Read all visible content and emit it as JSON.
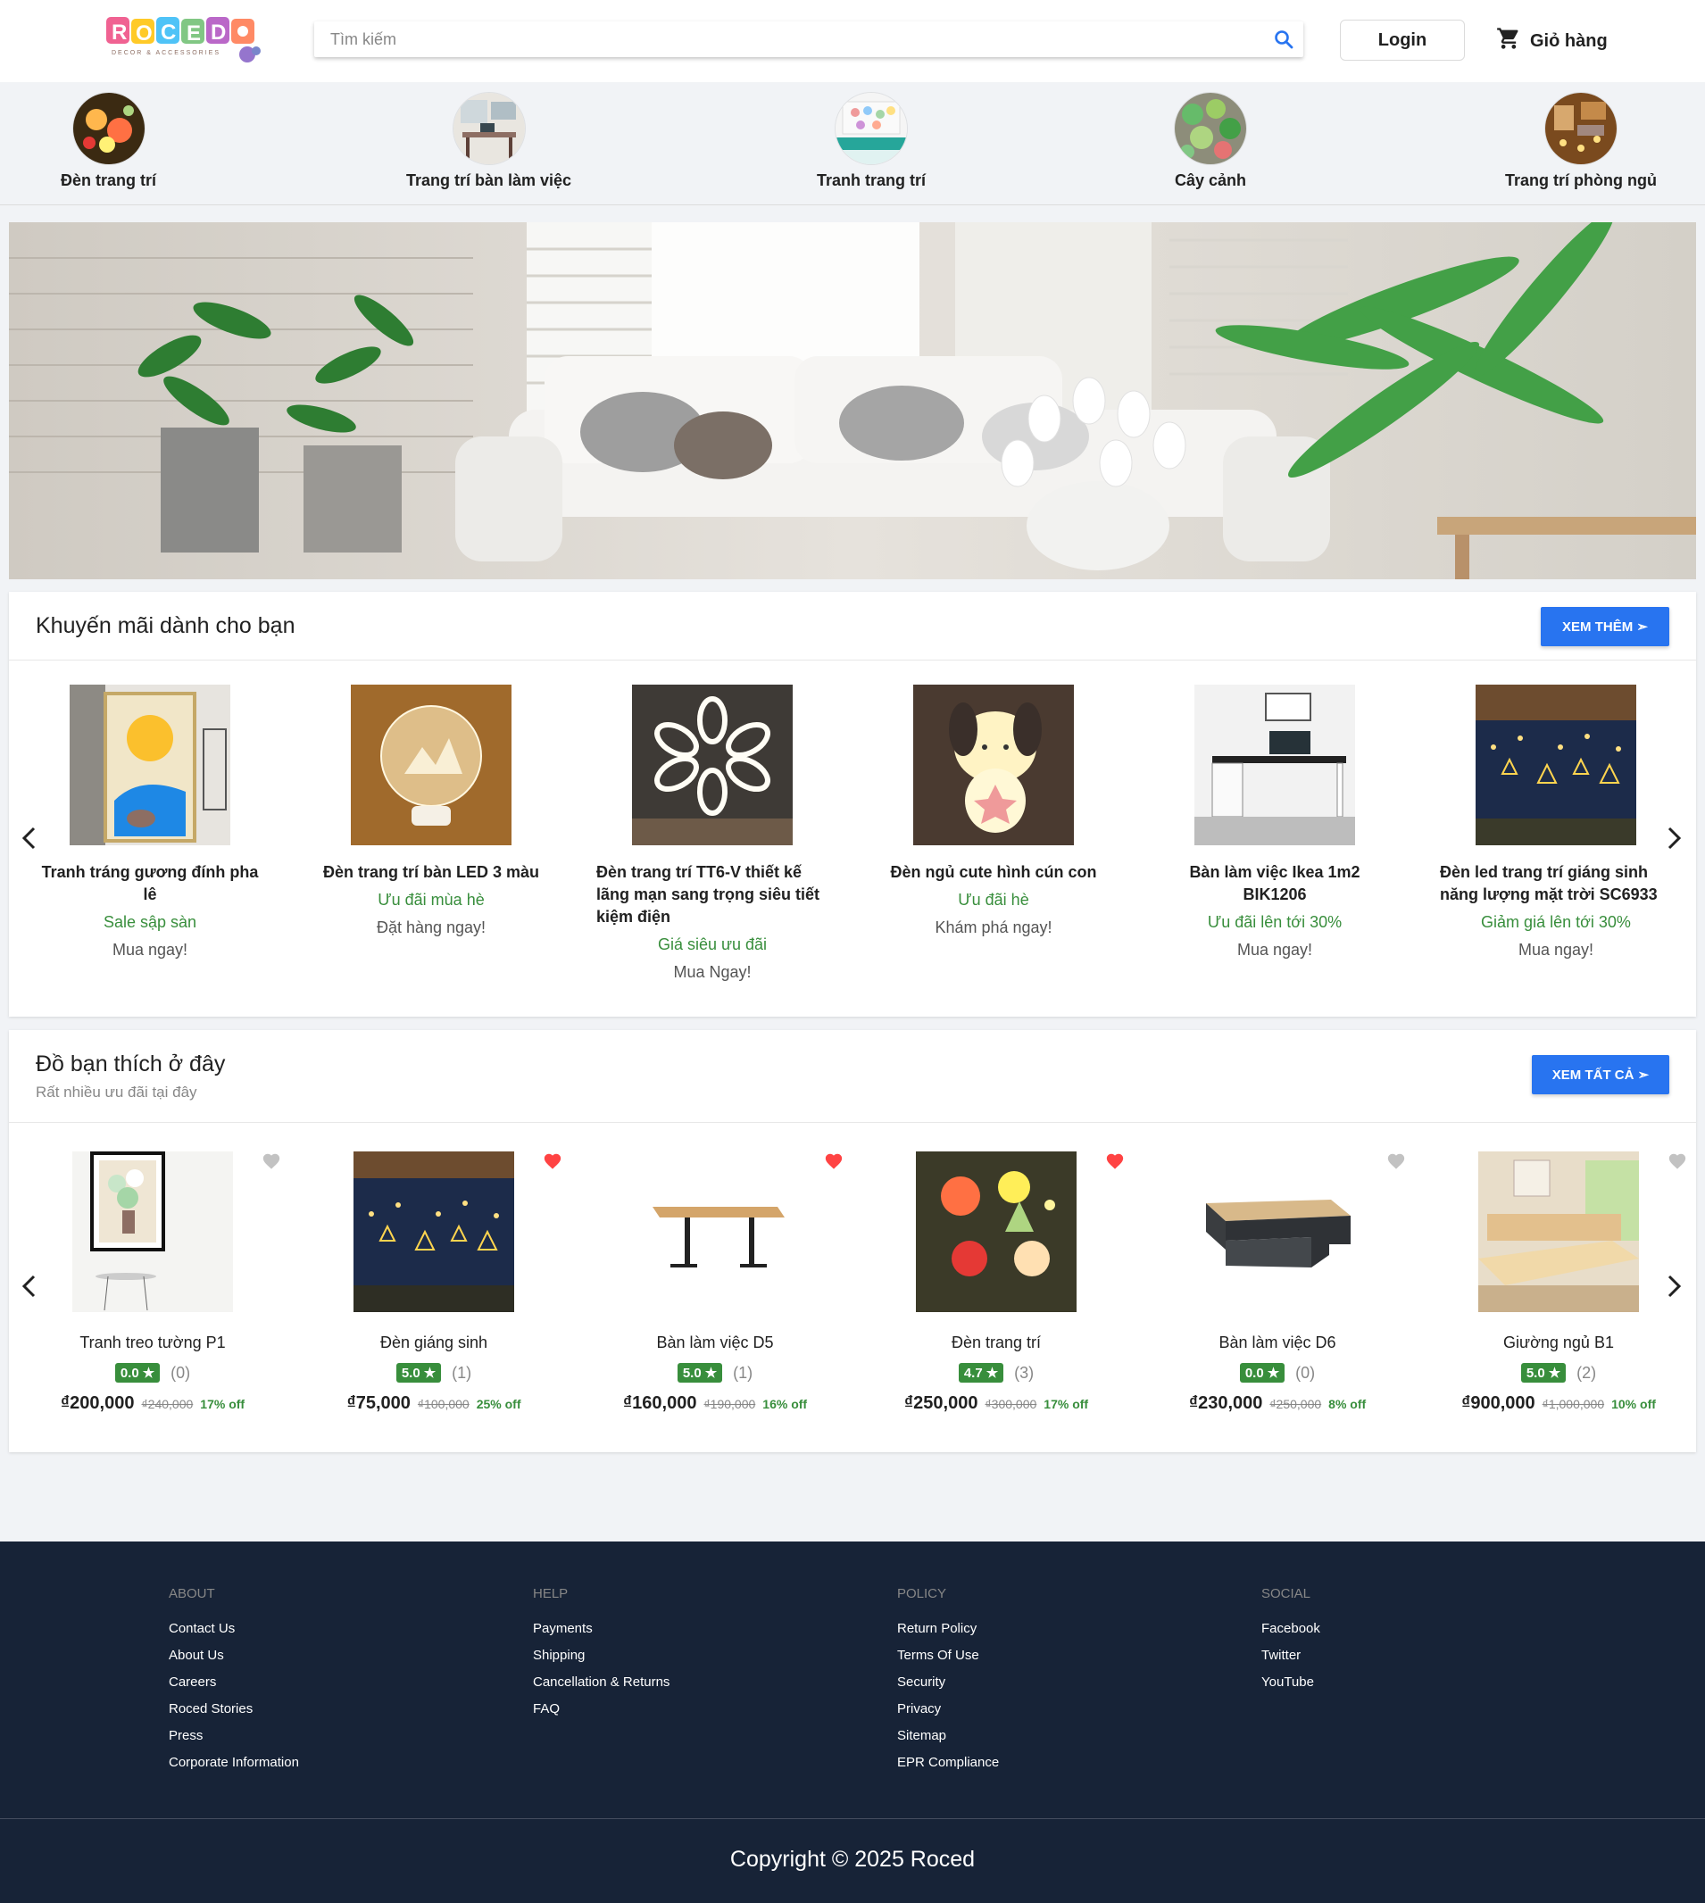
{
  "header": {
    "logo_text": "ROCED",
    "logo_tagline": "DECOR & ACCESSORIES",
    "search_placeholder": "Tìm kiếm",
    "login_label": "Login",
    "cart_label": "Giỏ hàng"
  },
  "categories": [
    {
      "label": "Đèn trang trí"
    },
    {
      "label": "Trang trí bàn làm việc"
    },
    {
      "label": "Tranh trang trí"
    },
    {
      "label": "Cây cảnh"
    },
    {
      "label": "Trang trí phòng ngủ"
    }
  ],
  "promo": {
    "title": "Khuyến mãi dành cho bạn",
    "button": "XEM THÊM ➣",
    "items": [
      {
        "name": "Tranh tráng gương đính pha lê",
        "offer": "Sale sập sàn",
        "cta": "Mua ngay!"
      },
      {
        "name": "Đèn trang trí bàn LED 3 màu",
        "offer": "Ưu đãi mùa hè",
        "cta": "Đặt hàng ngay!"
      },
      {
        "name": "Đèn trang trí TT6-V thiết kế lãng mạn sang trọng siêu tiết kiệm điện",
        "offer": "Giá siêu ưu đãi",
        "cta": "Mua Ngay!"
      },
      {
        "name": "Đèn ngủ cute hình cún con",
        "offer": "Ưu đãi hè",
        "cta": "Khám phá ngay!"
      },
      {
        "name": "Bàn làm việc Ikea 1m2 BIK1206",
        "offer": "Ưu đãi lên tới 30%",
        "cta": "Mua ngay!"
      },
      {
        "name": "Đèn led trang trí giáng sinh năng lượng mặt trời SC6933",
        "offer": "Giảm giá lên tới 30%",
        "cta": "Mua ngay!"
      }
    ]
  },
  "favorites": {
    "title": "Đồ bạn thích ở đây",
    "subtitle": "Rất nhiều ưu đãi tại đây",
    "button": "XEM TẤT CẢ ➣",
    "items": [
      {
        "name": "Tranh treo tường P1",
        "rating": "0.0",
        "count": "(0)",
        "price": "₫200,000",
        "old": "₫240,000",
        "off": "17% off",
        "liked": false
      },
      {
        "name": "Đèn giáng sinh",
        "rating": "5.0",
        "count": "(1)",
        "price": "₫75,000",
        "old": "₫100,000",
        "off": "25% off",
        "liked": true
      },
      {
        "name": "Bàn làm việc D5",
        "rating": "5.0",
        "count": "(1)",
        "price": "₫160,000",
        "old": "₫190,000",
        "off": "16% off",
        "liked": true
      },
      {
        "name": "Đèn trang trí",
        "rating": "4.7",
        "count": "(3)",
        "price": "₫250,000",
        "old": "₫300,000",
        "off": "17% off",
        "liked": true
      },
      {
        "name": "Bàn làm việc D6",
        "rating": "0.0",
        "count": "(0)",
        "price": "₫230,000",
        "old": "₫250,000",
        "off": "8% off",
        "liked": false
      },
      {
        "name": "Giường ngủ B1",
        "rating": "5.0",
        "count": "(2)",
        "price": "₫900,000",
        "old": "₫1,000,000",
        "off": "10% off",
        "liked": false
      }
    ]
  },
  "footer": {
    "columns": [
      {
        "heading": "ABOUT",
        "links": [
          "Contact Us",
          "About Us",
          "Careers",
          "Roced Stories",
          "Press",
          "Corporate Information"
        ]
      },
      {
        "heading": "HELP",
        "links": [
          "Payments",
          "Shipping",
          "Cancellation & Returns",
          "FAQ"
        ]
      },
      {
        "heading": "POLICY",
        "links": [
          "Return Policy",
          "Terms Of Use",
          "Security",
          "Privacy",
          "Sitemap",
          "EPR Compliance"
        ]
      },
      {
        "heading": "SOCIAL",
        "links": [
          "Facebook",
          "Twitter",
          "YouTube"
        ]
      }
    ],
    "copyright": "Copyright © 2025 Roced"
  },
  "colors": {
    "accent": "#2874f0",
    "green": "#388e3c",
    "footer_bg": "#172337",
    "heart_active": "#ff4343",
    "heart_inactive": "#c2c2c2"
  },
  "icons": [
    "search-icon",
    "cart-icon",
    "chevron-left-icon",
    "chevron-right-icon",
    "heart-icon",
    "star-icon"
  ]
}
